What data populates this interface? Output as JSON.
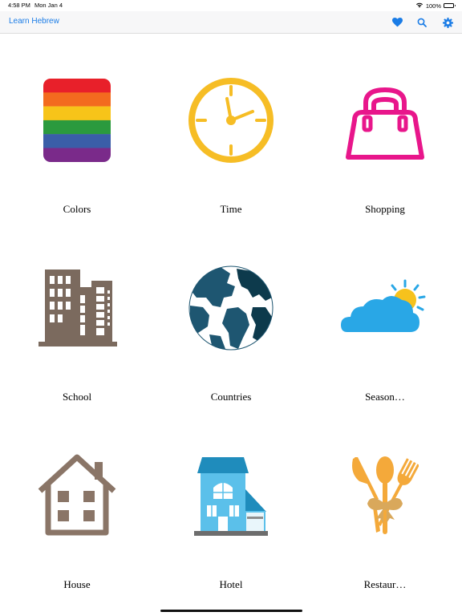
{
  "status_bar": {
    "time": "4:58 PM",
    "date": "Mon Jan 4",
    "battery": "100%"
  },
  "nav": {
    "back_label": "Learn Hebrew",
    "accent_color": "#1a7ce6",
    "icons": [
      "heart-icon",
      "search-icon",
      "gear-icon"
    ]
  },
  "categories": [
    {
      "label": "Colors",
      "icon": "rainbow-icon"
    },
    {
      "label": "Time",
      "icon": "clock-icon"
    },
    {
      "label": "Shopping",
      "icon": "handbag-icon"
    },
    {
      "label": "School",
      "icon": "buildings-icon"
    },
    {
      "label": "Countries",
      "icon": "globe-icon"
    },
    {
      "label": "Season…",
      "icon": "weather-icon"
    },
    {
      "label": "House",
      "icon": "house-icon"
    },
    {
      "label": "Hotel",
      "icon": "hotel-icon"
    },
    {
      "label": "Restaur…",
      "icon": "cutlery-icon"
    }
  ]
}
